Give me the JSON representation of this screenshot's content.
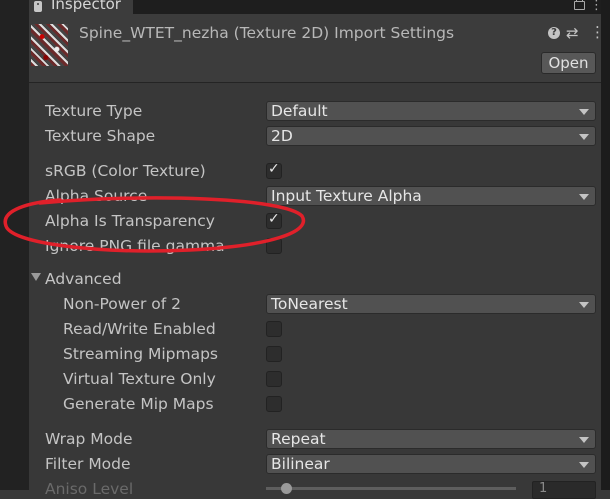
{
  "window": {
    "tab_label": "Inspector",
    "tab_icon": "inspector-icon"
  },
  "header": {
    "title": "Spine_WTET_nezha (Texture 2D) Import Settings",
    "open_label": "Open",
    "help_glyph": "?"
  },
  "settings": {
    "texture_type": {
      "label": "Texture Type",
      "value": "Default"
    },
    "texture_shape": {
      "label": "Texture Shape",
      "value": "2D"
    },
    "srgb": {
      "label": "sRGB (Color Texture)",
      "checked": true
    },
    "alpha_source": {
      "label": "Alpha Source",
      "value": "Input Texture Alpha"
    },
    "alpha_is_transparency": {
      "label": "Alpha Is Transparency",
      "checked": true
    },
    "ignore_png_gamma": {
      "label": "Ignore PNG file gamma",
      "checked": false
    },
    "advanced": {
      "label": "Advanced",
      "expanded": true,
      "non_power_of_2": {
        "label": "Non-Power of 2",
        "value": "ToNearest"
      },
      "read_write": {
        "label": "Read/Write Enabled",
        "checked": false
      },
      "streaming_mipmaps": {
        "label": "Streaming Mipmaps",
        "checked": false
      },
      "virtual_texture_only": {
        "label": "Virtual Texture Only",
        "checked": false
      },
      "generate_mip_maps": {
        "label": "Generate Mip Maps",
        "checked": false
      }
    },
    "wrap_mode": {
      "label": "Wrap Mode",
      "value": "Repeat"
    },
    "filter_mode": {
      "label": "Filter Mode",
      "value": "Bilinear"
    },
    "aniso_level": {
      "label": "Aniso Level",
      "value": "1"
    }
  },
  "annotation": {
    "color": "#e0202a"
  },
  "check_glyph": "✓"
}
